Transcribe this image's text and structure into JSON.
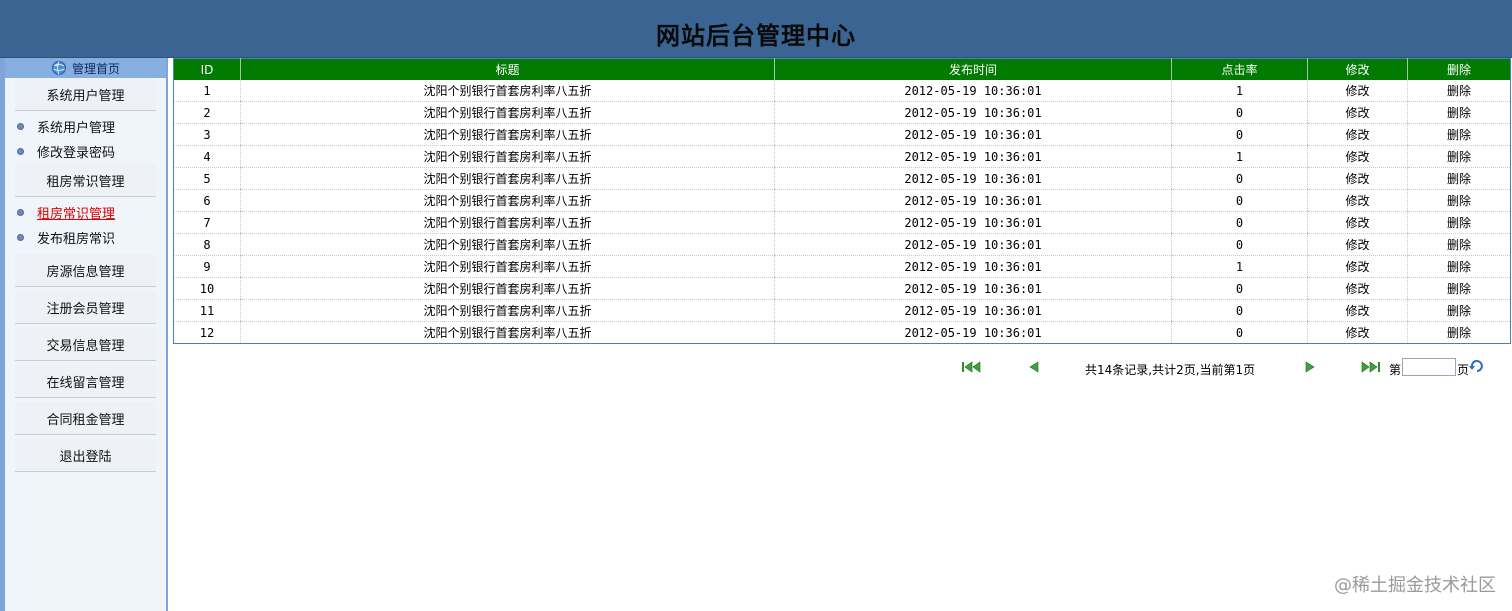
{
  "header": {
    "title": "网站后台管理中心"
  },
  "sidebar": {
    "home_label": "管理首页",
    "groups": [
      {
        "label": "系统用户管理"
      },
      {
        "label": "租房常识管理"
      },
      {
        "label": "房源信息管理"
      },
      {
        "label": "注册会员管理"
      },
      {
        "label": "交易信息管理"
      },
      {
        "label": "在线留言管理"
      },
      {
        "label": "合同租金管理"
      },
      {
        "label": "退出登陆"
      }
    ],
    "subitems": [
      {
        "label": "系统用户管理"
      },
      {
        "label": "修改登录密码"
      },
      {
        "label": "租房常识管理"
      },
      {
        "label": "发布租房常识"
      }
    ]
  },
  "table": {
    "headers": [
      "ID",
      "标题",
      "发布时间",
      "点击率",
      "修改",
      "删除"
    ],
    "rows": [
      {
        "id": "1",
        "title": "沈阳个别银行首套房利率八五折",
        "time": "2012-05-19 10:36:01",
        "clicks": "1",
        "edit": "修改",
        "del": "删除"
      },
      {
        "id": "2",
        "title": "沈阳个别银行首套房利率八五折",
        "time": "2012-05-19 10:36:01",
        "clicks": "0",
        "edit": "修改",
        "del": "删除"
      },
      {
        "id": "3",
        "title": "沈阳个别银行首套房利率八五折",
        "time": "2012-05-19 10:36:01",
        "clicks": "0",
        "edit": "修改",
        "del": "删除"
      },
      {
        "id": "4",
        "title": "沈阳个别银行首套房利率八五折",
        "time": "2012-05-19 10:36:01",
        "clicks": "1",
        "edit": "修改",
        "del": "删除"
      },
      {
        "id": "5",
        "title": "沈阳个别银行首套房利率八五折",
        "time": "2012-05-19 10:36:01",
        "clicks": "0",
        "edit": "修改",
        "del": "删除"
      },
      {
        "id": "6",
        "title": "沈阳个别银行首套房利率八五折",
        "time": "2012-05-19 10:36:01",
        "clicks": "0",
        "edit": "修改",
        "del": "删除"
      },
      {
        "id": "7",
        "title": "沈阳个别银行首套房利率八五折",
        "time": "2012-05-19 10:36:01",
        "clicks": "0",
        "edit": "修改",
        "del": "删除"
      },
      {
        "id": "8",
        "title": "沈阳个别银行首套房利率八五折",
        "time": "2012-05-19 10:36:01",
        "clicks": "0",
        "edit": "修改",
        "del": "删除"
      },
      {
        "id": "9",
        "title": "沈阳个别银行首套房利率八五折",
        "time": "2012-05-19 10:36:01",
        "clicks": "1",
        "edit": "修改",
        "del": "删除"
      },
      {
        "id": "10",
        "title": "沈阳个别银行首套房利率八五折",
        "time": "2012-05-19 10:36:01",
        "clicks": "0",
        "edit": "修改",
        "del": "删除"
      },
      {
        "id": "11",
        "title": "沈阳个别银行首套房利率八五折",
        "time": "2012-05-19 10:36:01",
        "clicks": "0",
        "edit": "修改",
        "del": "删除"
      },
      {
        "id": "12",
        "title": "沈阳个别银行首套房利率八五折",
        "time": "2012-05-19 10:36:01",
        "clicks": "0",
        "edit": "修改",
        "del": "删除"
      }
    ]
  },
  "pager": {
    "info": "共14条记录,共计2页,当前第1页",
    "page_label": "第",
    "page_suffix": "页",
    "page_input_value": ""
  },
  "watermark": "@稀土掘金技术社区",
  "colors": {
    "header_bg": "#3a6593",
    "table_header_bg": "#007a00",
    "active_link": "#e00000"
  }
}
